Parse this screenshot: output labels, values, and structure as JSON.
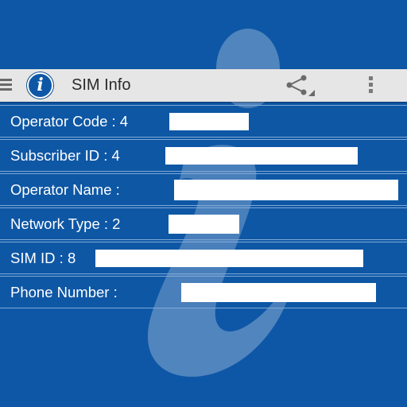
{
  "toolbar": {
    "app_title": "SIM Info",
    "logo_glyph": "i",
    "icons": [
      "menu-icon",
      "app-logo-icon",
      "share-icon",
      "overflow-menu-icon"
    ]
  },
  "rows": [
    {
      "label": "Operator Code : 4",
      "value": "[redacted]"
    },
    {
      "label": "Subscriber ID : 4",
      "value": "[redacted]"
    },
    {
      "label": "Operator Name :",
      "value": "[redacted]"
    },
    {
      "label": "Network Type : 2",
      "value": "[redacted]"
    },
    {
      "label": "SIM ID : 8",
      "value": "[redacted]"
    },
    {
      "label": "Phone Number :",
      "value": "[redacted]"
    }
  ],
  "colors": {
    "background": "#0e57a6",
    "toolbar": "#e6e6e6",
    "text": "#ffffff",
    "row_border": "#7fa9d6"
  }
}
